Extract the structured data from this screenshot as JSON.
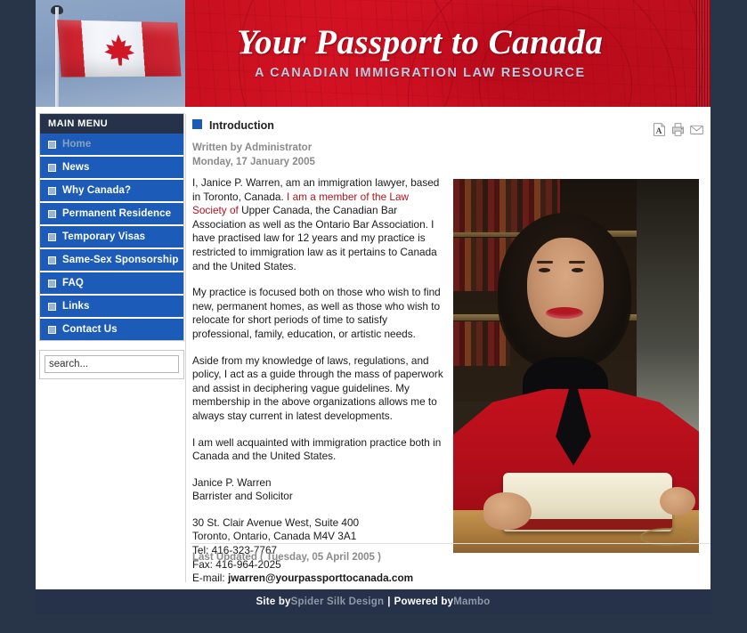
{
  "site": {
    "title": "Your Passport to Canada",
    "tagline": "A CANADIAN  IMMIGRATION LAW RESOURCE",
    "flag_alt": "canadian-flag"
  },
  "colors": {
    "page_background": "#283447",
    "banner_red": "#d81325",
    "menu_blue": "#1c5bb8",
    "menu_header_navy": "#26324a",
    "bullet_light_blue": "#97b4d8",
    "active_link_gray": "#8ba2bd",
    "byline_gray": "#8b8b8b",
    "accent_red_link": "#b6121c"
  },
  "sidebar": {
    "menu_title": "MAIN MENU",
    "items": [
      {
        "label": "Home",
        "active": true
      },
      {
        "label": "News",
        "active": false
      },
      {
        "label": "Why Canada?",
        "active": false
      },
      {
        "label": "Permanent Residence",
        "active": false
      },
      {
        "label": "Temporary Visas",
        "active": false
      },
      {
        "label": "Same-Sex Sponsorship",
        "active": false
      },
      {
        "label": "FAQ",
        "active": false
      },
      {
        "label": "Links",
        "active": false
      },
      {
        "label": "Contact Us",
        "active": false
      }
    ],
    "search": {
      "placeholder": "search...",
      "value": ""
    }
  },
  "article": {
    "title": "Introduction",
    "written_by": "Written by Administrator",
    "date": "Monday, 17 January 2005",
    "para1_a": "I, Janice P. Warren, am an immigration lawyer, based in Toronto, Canada. ",
    "para1_link": "I am a member of the Law Society of",
    "para1_b": " Upper Canada, the Canadian Bar Association as well as the Ontario Bar Association. I have practised law for 12 years and my practice is restricted to immigration law as it pertains to Canada and the United States.",
    "para2": "My practice is focused both on those who wish to find new, permanent homes, as well as those who wish to relocate for short periods of time to satisfy professional, family, education, or artistic needs.",
    "para3": "Aside from my knowledge of laws, regulations, and policy, I act as a guide through the mass of paperwork and assist in deciphering vague guidelines. My membership in the above organizations allows me to always stay current in latest developments.",
    "para4": "I am well acquainted with immigration practice both in Canada and the United States.",
    "signature_name": "Janice P. Warren",
    "signature_role": "Barrister and Solicitor",
    "address_line1": "30 St. Clair Avenue West, Suite 400",
    "address_line2": "Toronto, Ontario, Canada M4V 3A1",
    "tel": "Tel: 416-323-7767",
    "fax": "Fax: 416-964-2025",
    "email_label": "E-mail: ",
    "email": "jwarren@yourpassporttocanada.com",
    "last_updated": "Last Updated ( Tuesday, 05 April 2005 )",
    "photo_alt": "portrait-of-janice-p-warren"
  },
  "toolbar": {
    "pdf_icon": "pdf-icon",
    "print_icon": "print-icon",
    "email_icon": "email-icon"
  },
  "footer": {
    "site_by_label": "Site by ",
    "designer": "Spider Silk Design",
    "separator": " | ",
    "powered_by_label": "Powered by ",
    "platform": "Mambo"
  }
}
